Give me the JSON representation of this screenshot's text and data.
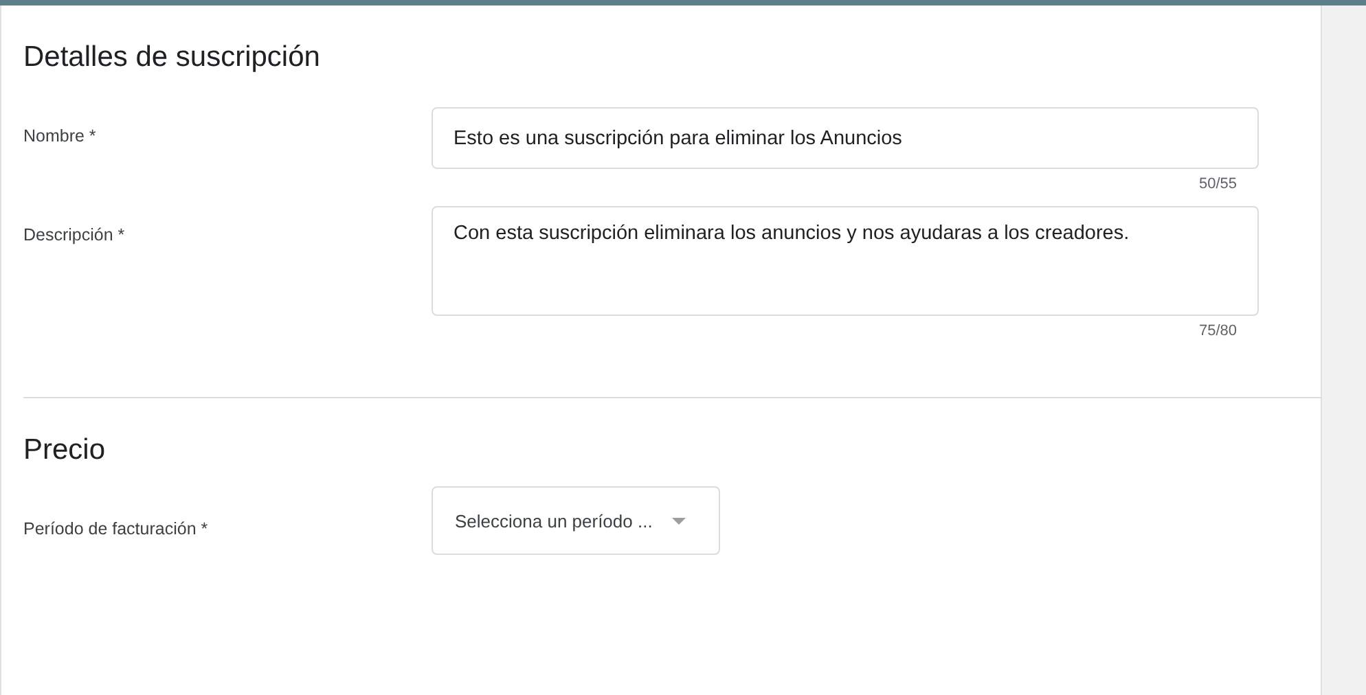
{
  "sections": [
    {
      "title": "Detalles de suscripción",
      "fields": [
        {
          "kind": "text",
          "label": "Nombre *",
          "value": "Esto es una suscripción para eliminar los Anuncios",
          "counter": "50/55"
        },
        {
          "kind": "textarea",
          "label": "Descripción *",
          "value": "Con esta suscripción eliminara los anuncios y nos ayudaras a los creadores.",
          "counter": "75/80"
        }
      ]
    },
    {
      "title": "Precio",
      "fields": [
        {
          "kind": "select",
          "label": "Período de facturación *",
          "placeholder": "Selecciona un período ..."
        }
      ]
    }
  ]
}
